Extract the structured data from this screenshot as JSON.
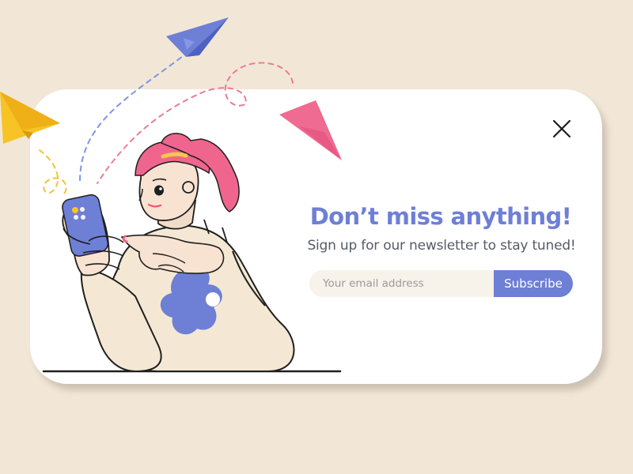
{
  "popup": {
    "headline": "Don’t miss anything!",
    "subtitle": "Sign up for our newsletter to stay tuned!",
    "email_placeholder": "Your email address",
    "subscribe_label": "Subscribe"
  },
  "colors": {
    "background": "#f2e7d7",
    "card": "#ffffff",
    "accent": "#6e7fd6",
    "input_background": "#f7f2ea",
    "hair": "#f0658d",
    "paper_plane_blue": "#6e7fd6",
    "paper_plane_pink": "#ef5a86",
    "paper_plane_yellow": "#f7c325",
    "sweater": "#f4e8d4"
  },
  "icons": {
    "close": "close-icon",
    "plane_blue": "paper-plane-icon",
    "plane_pink": "paper-plane-icon",
    "plane_yellow": "paper-plane-icon"
  }
}
